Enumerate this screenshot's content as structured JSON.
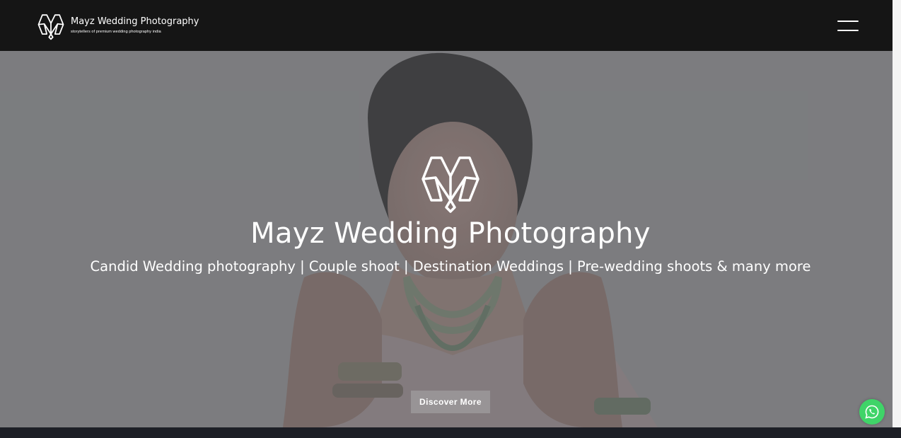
{
  "brand": {
    "name": "Mayz Wedding Photography",
    "tagline": "storytellers of premium wedding photography india",
    "logo_icon": "mayz-m-monogram"
  },
  "header": {
    "menu_icon": "hamburger-menu-icon"
  },
  "hero": {
    "title": "Mayz Wedding Photography",
    "subtitle": "Candid Wedding photography | Couple shoot | Destination Weddings | Pre-wedding shoots & many more",
    "button_label": "Discover More",
    "logo_icon": "mayz-m-monogram"
  },
  "floating": {
    "whatsapp_icon": "whatsapp-icon"
  },
  "colors": {
    "header_bg": "#151515",
    "hero_overlay": "#808183",
    "whatsapp_green": "#3fd468",
    "text": "#ffffff"
  }
}
